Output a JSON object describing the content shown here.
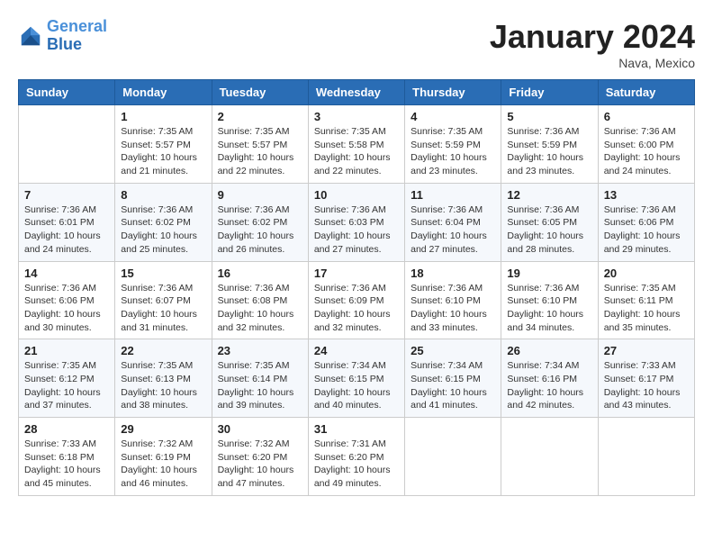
{
  "logo": {
    "line1": "General",
    "line2": "Blue"
  },
  "title": "January 2024",
  "location": "Nava, Mexico",
  "days_of_week": [
    "Sunday",
    "Monday",
    "Tuesday",
    "Wednesday",
    "Thursday",
    "Friday",
    "Saturday"
  ],
  "weeks": [
    [
      {
        "day": "",
        "info": ""
      },
      {
        "day": "1",
        "info": "Sunrise: 7:35 AM\nSunset: 5:57 PM\nDaylight: 10 hours\nand 21 minutes."
      },
      {
        "day": "2",
        "info": "Sunrise: 7:35 AM\nSunset: 5:57 PM\nDaylight: 10 hours\nand 22 minutes."
      },
      {
        "day": "3",
        "info": "Sunrise: 7:35 AM\nSunset: 5:58 PM\nDaylight: 10 hours\nand 22 minutes."
      },
      {
        "day": "4",
        "info": "Sunrise: 7:35 AM\nSunset: 5:59 PM\nDaylight: 10 hours\nand 23 minutes."
      },
      {
        "day": "5",
        "info": "Sunrise: 7:36 AM\nSunset: 5:59 PM\nDaylight: 10 hours\nand 23 minutes."
      },
      {
        "day": "6",
        "info": "Sunrise: 7:36 AM\nSunset: 6:00 PM\nDaylight: 10 hours\nand 24 minutes."
      }
    ],
    [
      {
        "day": "7",
        "info": "Sunrise: 7:36 AM\nSunset: 6:01 PM\nDaylight: 10 hours\nand 24 minutes."
      },
      {
        "day": "8",
        "info": "Sunrise: 7:36 AM\nSunset: 6:02 PM\nDaylight: 10 hours\nand 25 minutes."
      },
      {
        "day": "9",
        "info": "Sunrise: 7:36 AM\nSunset: 6:02 PM\nDaylight: 10 hours\nand 26 minutes."
      },
      {
        "day": "10",
        "info": "Sunrise: 7:36 AM\nSunset: 6:03 PM\nDaylight: 10 hours\nand 27 minutes."
      },
      {
        "day": "11",
        "info": "Sunrise: 7:36 AM\nSunset: 6:04 PM\nDaylight: 10 hours\nand 27 minutes."
      },
      {
        "day": "12",
        "info": "Sunrise: 7:36 AM\nSunset: 6:05 PM\nDaylight: 10 hours\nand 28 minutes."
      },
      {
        "day": "13",
        "info": "Sunrise: 7:36 AM\nSunset: 6:06 PM\nDaylight: 10 hours\nand 29 minutes."
      }
    ],
    [
      {
        "day": "14",
        "info": "Sunrise: 7:36 AM\nSunset: 6:06 PM\nDaylight: 10 hours\nand 30 minutes."
      },
      {
        "day": "15",
        "info": "Sunrise: 7:36 AM\nSunset: 6:07 PM\nDaylight: 10 hours\nand 31 minutes."
      },
      {
        "day": "16",
        "info": "Sunrise: 7:36 AM\nSunset: 6:08 PM\nDaylight: 10 hours\nand 32 minutes."
      },
      {
        "day": "17",
        "info": "Sunrise: 7:36 AM\nSunset: 6:09 PM\nDaylight: 10 hours\nand 32 minutes."
      },
      {
        "day": "18",
        "info": "Sunrise: 7:36 AM\nSunset: 6:10 PM\nDaylight: 10 hours\nand 33 minutes."
      },
      {
        "day": "19",
        "info": "Sunrise: 7:36 AM\nSunset: 6:10 PM\nDaylight: 10 hours\nand 34 minutes."
      },
      {
        "day": "20",
        "info": "Sunrise: 7:35 AM\nSunset: 6:11 PM\nDaylight: 10 hours\nand 35 minutes."
      }
    ],
    [
      {
        "day": "21",
        "info": "Sunrise: 7:35 AM\nSunset: 6:12 PM\nDaylight: 10 hours\nand 37 minutes."
      },
      {
        "day": "22",
        "info": "Sunrise: 7:35 AM\nSunset: 6:13 PM\nDaylight: 10 hours\nand 38 minutes."
      },
      {
        "day": "23",
        "info": "Sunrise: 7:35 AM\nSunset: 6:14 PM\nDaylight: 10 hours\nand 39 minutes."
      },
      {
        "day": "24",
        "info": "Sunrise: 7:34 AM\nSunset: 6:15 PM\nDaylight: 10 hours\nand 40 minutes."
      },
      {
        "day": "25",
        "info": "Sunrise: 7:34 AM\nSunset: 6:15 PM\nDaylight: 10 hours\nand 41 minutes."
      },
      {
        "day": "26",
        "info": "Sunrise: 7:34 AM\nSunset: 6:16 PM\nDaylight: 10 hours\nand 42 minutes."
      },
      {
        "day": "27",
        "info": "Sunrise: 7:33 AM\nSunset: 6:17 PM\nDaylight: 10 hours\nand 43 minutes."
      }
    ],
    [
      {
        "day": "28",
        "info": "Sunrise: 7:33 AM\nSunset: 6:18 PM\nDaylight: 10 hours\nand 45 minutes."
      },
      {
        "day": "29",
        "info": "Sunrise: 7:32 AM\nSunset: 6:19 PM\nDaylight: 10 hours\nand 46 minutes."
      },
      {
        "day": "30",
        "info": "Sunrise: 7:32 AM\nSunset: 6:20 PM\nDaylight: 10 hours\nand 47 minutes."
      },
      {
        "day": "31",
        "info": "Sunrise: 7:31 AM\nSunset: 6:20 PM\nDaylight: 10 hours\nand 49 minutes."
      },
      {
        "day": "",
        "info": ""
      },
      {
        "day": "",
        "info": ""
      },
      {
        "day": "",
        "info": ""
      }
    ]
  ]
}
